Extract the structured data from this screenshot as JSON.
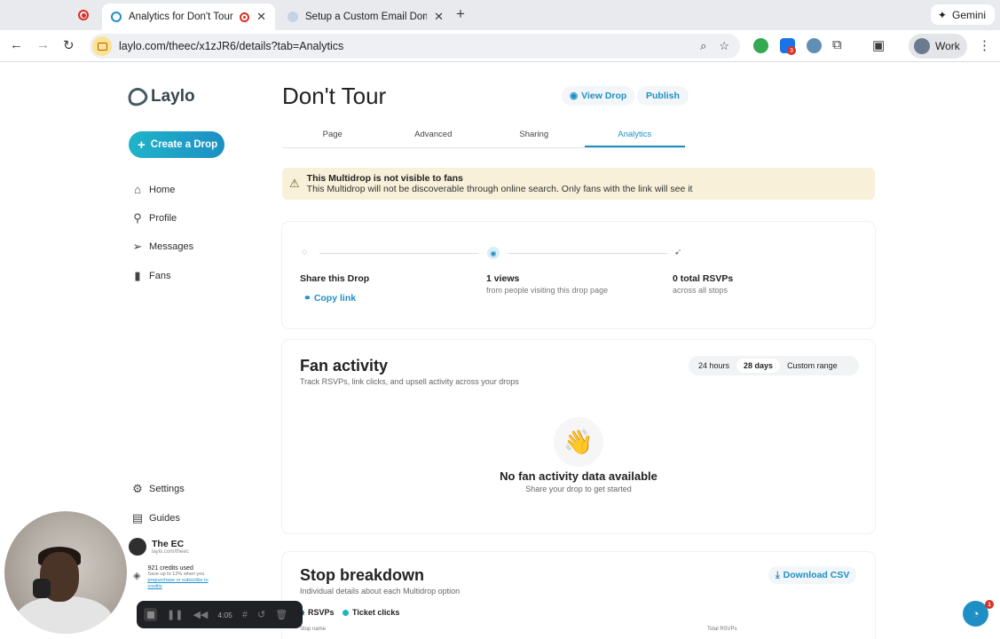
{
  "browser": {
    "tabs": [
      {
        "title": "Analytics for Don't Tour -",
        "active": true
      },
      {
        "title": "Setup a Custom Email Domain",
        "active": false
      }
    ],
    "new_tab_icon": "plus-icon",
    "gemini_label": "Gemini",
    "url": "laylo.com/theec/x1zJR6/details?tab=Analytics",
    "profile_label": "Work",
    "extension_badge": "3"
  },
  "sidebar": {
    "logo_text": "Laylo",
    "create_label": "Create a Drop",
    "nav": [
      {
        "label": "Home",
        "icon": "home-icon"
      },
      {
        "label": "Profile",
        "icon": "user-icon"
      },
      {
        "label": "Messages",
        "icon": "send-icon"
      },
      {
        "label": "Fans",
        "icon": "bar-chart-icon"
      }
    ],
    "bottom_nav": [
      {
        "label": "Settings",
        "icon": "gear-icon"
      },
      {
        "label": "Guides",
        "icon": "book-icon"
      }
    ],
    "user": {
      "name": "The EC",
      "url": "laylo.com/theec"
    },
    "credits": {
      "used": "921 credits used",
      "note": "Save up to 12% when you",
      "link": "prepurchase or subscribe to credits"
    }
  },
  "header": {
    "title": "Don't Tour",
    "view_drop": "View Drop",
    "publish": "Publish"
  },
  "tabs": [
    "Page",
    "Advanced",
    "Sharing",
    "Analytics"
  ],
  "active_tab": "Analytics",
  "banner": {
    "title": "This Multidrop is not visible to fans",
    "text": "This Multidrop will not be discoverable through online search. Only fans with the link will see it"
  },
  "stats": {
    "share": {
      "title": "Share this Drop",
      "link": "Copy link"
    },
    "views": {
      "title": "1 views",
      "sub": "from people visiting this drop page"
    },
    "rsvps": {
      "title": "0 total RSVPs",
      "sub": "across all stops"
    }
  },
  "fan_activity": {
    "title": "Fan activity",
    "subtitle": "Track RSVPs, link clicks, and upsell activity across your drops",
    "ranges": [
      "24 hours",
      "28 days",
      "Custom range"
    ],
    "selected_range": "28 days",
    "empty_emoji": "👋",
    "empty_title": "No fan activity data available",
    "empty_sub": "Share your drop to get started"
  },
  "stop_breakdown": {
    "title": "Stop breakdown",
    "subtitle": "Individual details about each Multidrop option",
    "download": "Download CSV",
    "legend": [
      {
        "label": "RSVPs",
        "color": "#2b6f86"
      },
      {
        "label": "Ticket clicks",
        "color": "#1fb4c8"
      }
    ],
    "columns": [
      "Stop name",
      "Total RSVPs"
    ]
  },
  "recorder": {
    "time": "4:05"
  },
  "chat": {
    "badge": "1"
  }
}
